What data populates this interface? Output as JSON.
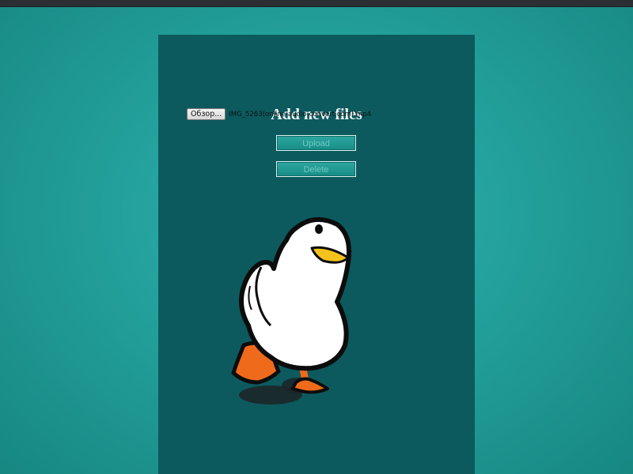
{
  "page": {
    "title": "Add new files"
  },
  "file_picker": {
    "browse_label": "Обзор...",
    "selected_file": "IMG_5263(online-audio-convert.com).mp4"
  },
  "actions": {
    "upload_label": "Upload",
    "delete_label": "Delete"
  },
  "colors": {
    "background": "#23a09b",
    "panel": "#0c5a5e",
    "button": "#1f9993",
    "duck_body": "#ffffff",
    "duck_feet": "#f06a1c",
    "duck_beak": "#f4c21c"
  },
  "illustration": {
    "icon": "duck-illustration"
  }
}
